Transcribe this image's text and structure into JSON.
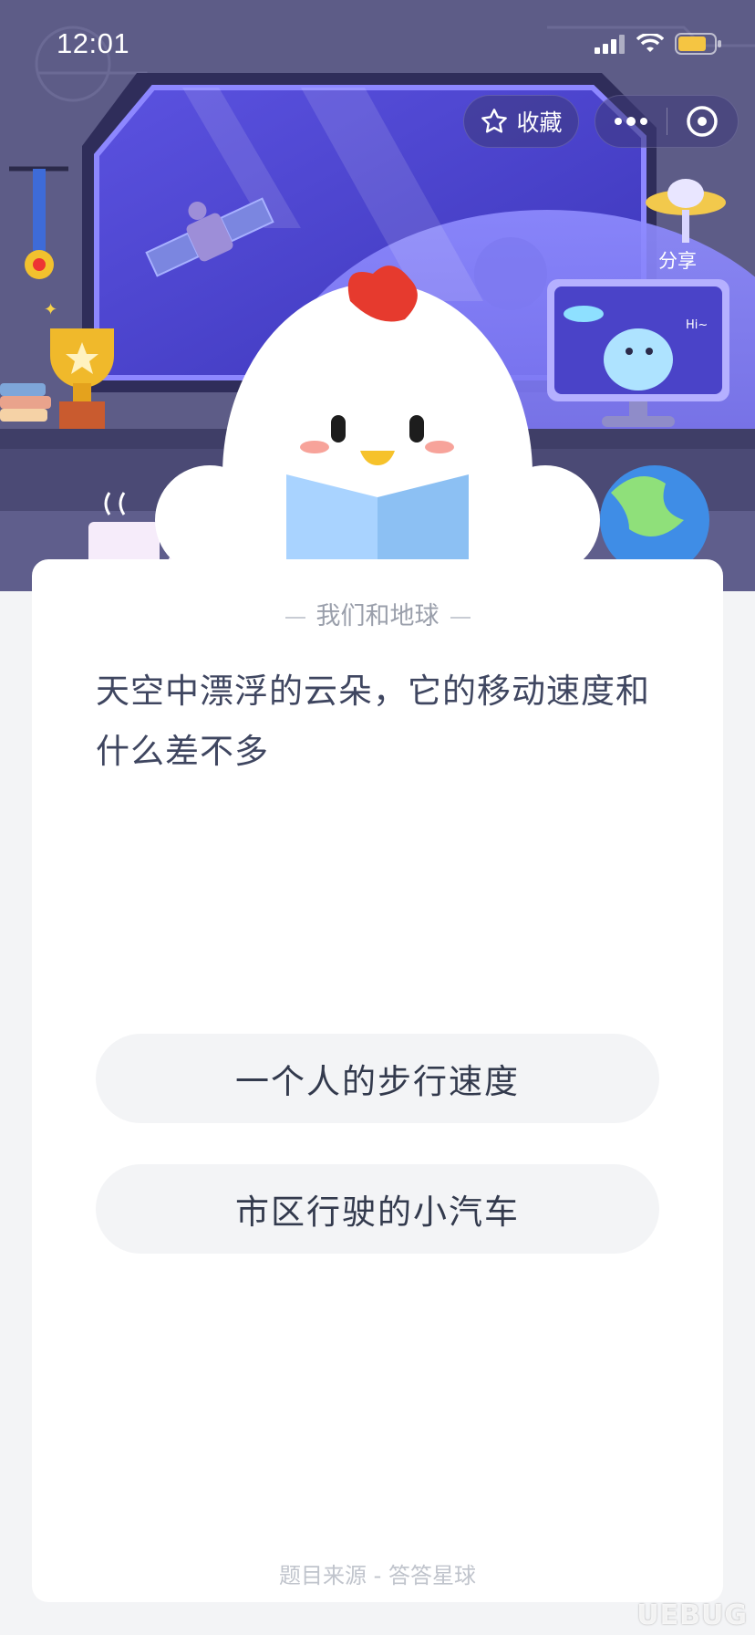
{
  "status_bar": {
    "time": "12:01"
  },
  "top_bar": {
    "favorite_label": "收藏",
    "share_label": "分享"
  },
  "scene": {
    "bubble_text": "Hi~"
  },
  "quiz": {
    "category": "我们和地球",
    "question": "天空中漂浮的云朵，它的移动速度和什么差不多",
    "options": [
      "一个人的步行速度",
      "市区行驶的小汽车"
    ],
    "source": "题目来源 - 答答星球"
  },
  "watermark": "UEBUG"
}
